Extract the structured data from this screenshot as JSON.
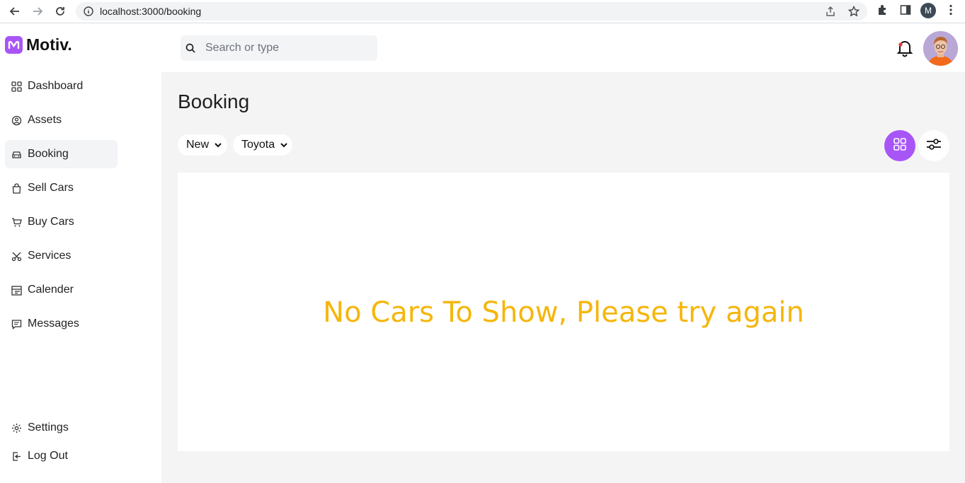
{
  "browser": {
    "url": "localhost:3000/booking",
    "profile_initial": "M"
  },
  "brand": {
    "name": "Motiv.",
    "accent": "#a855f7"
  },
  "sidebar": {
    "items": [
      {
        "label": "Dashboard",
        "icon": "grid-icon"
      },
      {
        "label": "Assets",
        "icon": "user-circle-icon"
      },
      {
        "label": "Booking",
        "icon": "car-icon",
        "active": true
      },
      {
        "label": "Sell Cars",
        "icon": "bag-icon"
      },
      {
        "label": "Buy Cars",
        "icon": "cart-icon"
      },
      {
        "label": "Services",
        "icon": "scissors-icon"
      },
      {
        "label": "Calender",
        "icon": "calendar-icon"
      },
      {
        "label": "Messages",
        "icon": "message-icon"
      }
    ],
    "bottom": [
      {
        "label": "Settings",
        "icon": "gear-icon"
      },
      {
        "label": "Log Out",
        "icon": "logout-icon"
      }
    ]
  },
  "header": {
    "search_placeholder": "Search or type"
  },
  "main": {
    "title": "Booking",
    "filters": [
      {
        "selected": "New"
      },
      {
        "selected": "Toyota"
      }
    ],
    "empty_message": "No Cars To Show, Please try again",
    "empty_color": "#f5b60c"
  }
}
